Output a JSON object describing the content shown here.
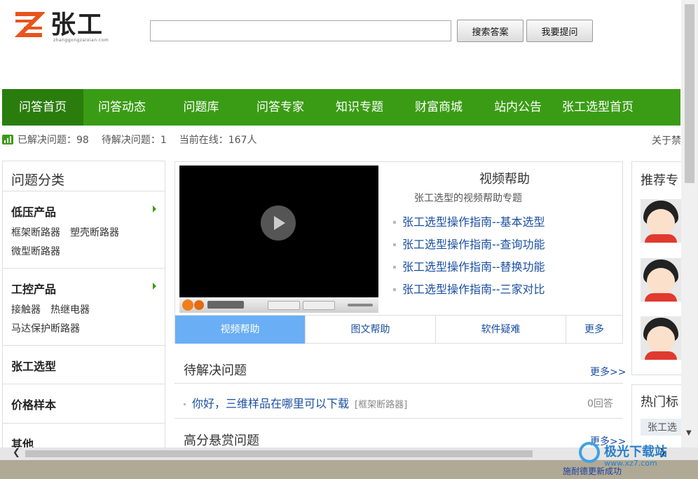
{
  "header": {
    "logo_text": "张工",
    "logo_sub": "zhanggongzaixian.com",
    "search_value": "",
    "search_button": "搜索答案",
    "ask_button": "我要提问"
  },
  "nav": {
    "items": [
      "问答首页",
      "问答动态",
      "问题库",
      "问答专家",
      "知识专题",
      "财富商城",
      "站内公告",
      "张工选型首页"
    ]
  },
  "stats": {
    "solved": "已解决问题：98",
    "pending": "待解决问题：1",
    "online": "当前在线：167人",
    "about": "关于禁"
  },
  "sidebar": {
    "title": "问题分类",
    "categories": [
      {
        "name": "低压产品",
        "links": [
          "框架断路器",
          "塑壳断路器",
          "微型断路器"
        ]
      },
      {
        "name": "工控产品",
        "links": [
          "接触器",
          "热继电器",
          "马达保护断路器"
        ]
      },
      {
        "name": "张工选型"
      },
      {
        "name": "价格样本"
      },
      {
        "name": "其他"
      }
    ]
  },
  "video": {
    "title": "视频帮助",
    "subtitle": "张工选型的视频帮助专题",
    "links": [
      "张工选型操作指南--基本选型",
      "张工选型操作指南--查询功能",
      "张工选型操作指南--替换功能",
      "张工选型操作指南--三家对比"
    ],
    "tabs": [
      "视频帮助",
      "图文帮助",
      "软件疑难",
      "更多"
    ],
    "active_tab": 0
  },
  "pending": {
    "title": "待解决问题",
    "more": "更多>>",
    "question": "你好，三维样品在哪里可以下载",
    "category": "[框架断路器]",
    "answers": "0回答"
  },
  "reward": {
    "title": "高分悬赏问题",
    "more": "更多>>"
  },
  "right": {
    "experts_title": "推荐专",
    "hot_title": "热门标",
    "hot_tag": "张工选"
  },
  "statusbar": {
    "message": "施耐德更新成功"
  },
  "watermark": {
    "name": "极光下载站",
    "url": "www.xz7.com"
  }
}
